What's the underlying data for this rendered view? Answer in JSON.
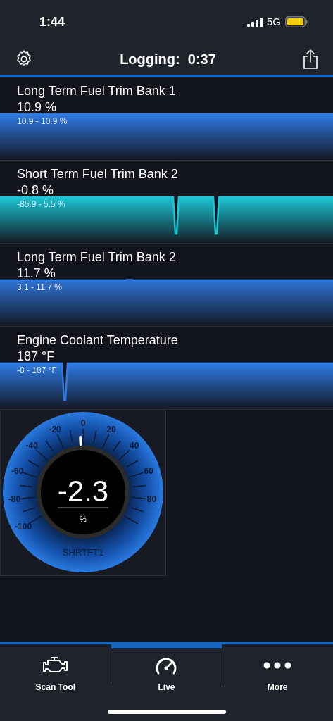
{
  "status_bar": {
    "time": "1:44",
    "network": "5G"
  },
  "header": {
    "title": "Logging:  0:37"
  },
  "graphs": [
    {
      "title": "Long Term Fuel Trim Bank 1",
      "value": "10.9 %",
      "range": "10.9 - 10.9 %",
      "color": "#2f7be6"
    },
    {
      "title": "Short Term Fuel Trim Bank 2",
      "value": "-0.8 %",
      "range": "-85.9 - 5.5 %",
      "color": "#1cc6d6"
    },
    {
      "title": "Long Term Fuel Trim Bank 2",
      "value": "11.7 %",
      "range": "3.1 - 11.7 %",
      "color": "#2f7be6"
    },
    {
      "title": "Engine Coolant Temperature",
      "value": "187 °F",
      "range": "-8 - 187 °F",
      "color": "#2f7be6"
    }
  ],
  "gauge": {
    "value": "-2.3",
    "unit": "%",
    "name": "SHRTFT1",
    "scale_labels": [
      "-100",
      "-80",
      "-60",
      "-40",
      "-20",
      "0",
      "20",
      "40",
      "60",
      "80"
    ]
  },
  "tabs": [
    {
      "label": "Scan Tool",
      "selected": false
    },
    {
      "label": "Live",
      "selected": true
    },
    {
      "label": "More",
      "selected": false
    }
  ]
}
